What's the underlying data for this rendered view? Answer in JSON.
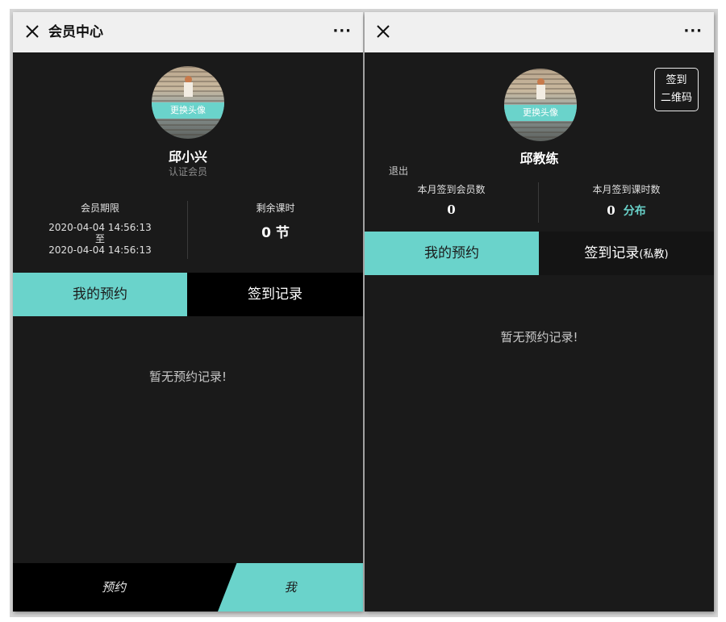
{
  "colors": {
    "accent": "#6ad3cb",
    "background": "#1a1a1a",
    "titlebar": "#f0f0f0",
    "tab_inactive": "#000000"
  },
  "left": {
    "titlebar": {
      "close_icon": "close-icon",
      "title": "会员中心",
      "more": "···"
    },
    "avatar": {
      "change_label": "更换头像"
    },
    "user": {
      "name": "邱小兴",
      "role": "认证会员"
    },
    "stats": {
      "period_label": "会员期限",
      "period_start": "2020-04-04 14:56:13",
      "period_to": "至",
      "period_end": "2020-04-04 14:56:13",
      "remaining_label": "剩余课时",
      "remaining_value": "0 节"
    },
    "tabs": [
      {
        "label": "我的预约",
        "active": true
      },
      {
        "label": "签到记录",
        "active": false
      }
    ],
    "empty_text": "暂无预约记录!",
    "bottom_nav": [
      {
        "label": "预约",
        "active": false
      },
      {
        "label": "我",
        "active": true
      }
    ]
  },
  "right": {
    "titlebar": {
      "close_icon": "close-icon",
      "more": "···"
    },
    "avatar": {
      "change_label": "更换头像"
    },
    "user": {
      "name": "邱教练"
    },
    "qr_button": {
      "line1": "签到",
      "line2": "二维码"
    },
    "logout": "退出",
    "stats": {
      "members_label": "本月签到会员数",
      "members_value": "0",
      "hours_label": "本月签到课时数",
      "hours_value": "0",
      "distribution_link": "分布"
    },
    "tabs": [
      {
        "label": "我的预约",
        "active": false
      },
      {
        "label": "签到记录",
        "suffix": "(私教)",
        "active": false
      }
    ],
    "empty_text": "暂无预约记录!"
  }
}
